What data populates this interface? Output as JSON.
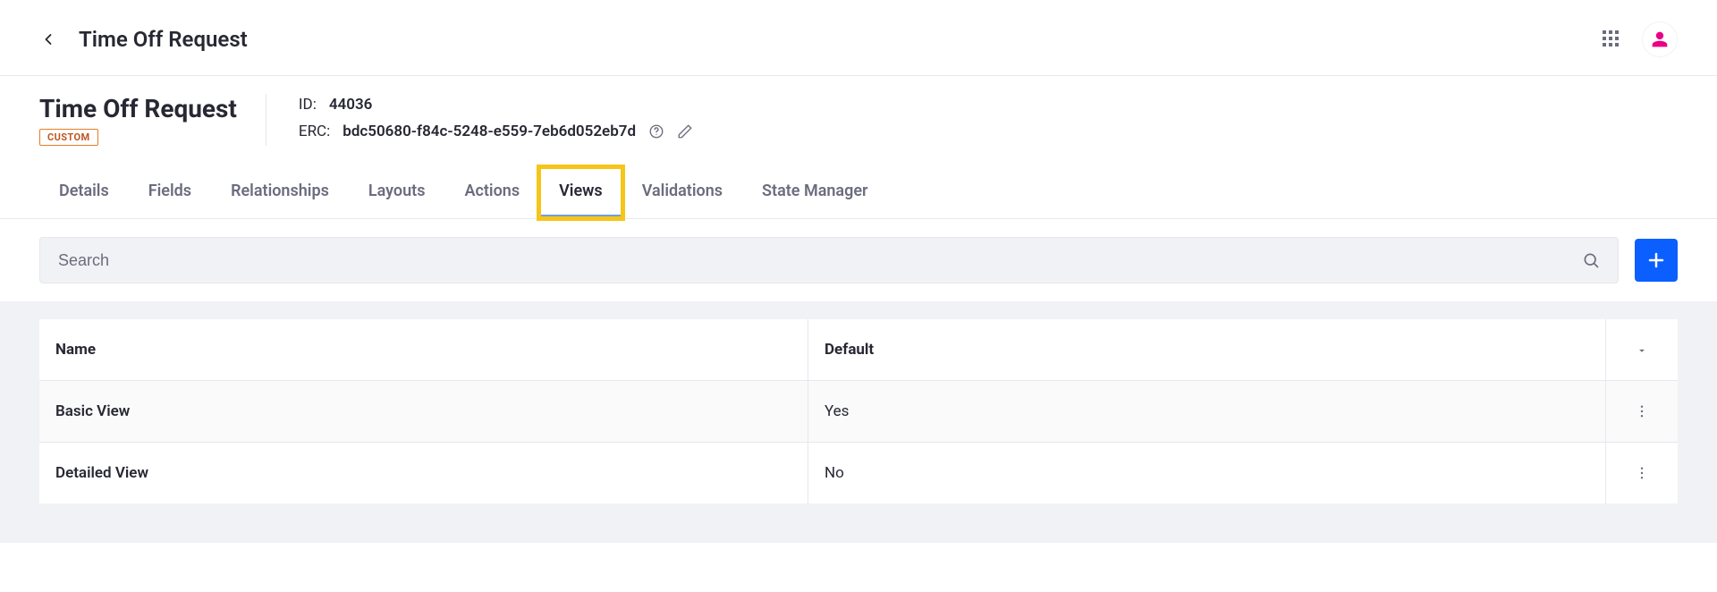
{
  "topbar": {
    "title": "Time Off Request"
  },
  "header": {
    "object_name": "Time Off Request",
    "badge": "CUSTOM",
    "id_label": "ID:",
    "id_value": "44036",
    "erc_label": "ERC:",
    "erc_value": "bdc50680-f84c-5248-e559-7eb6d052eb7d"
  },
  "tabs": [
    {
      "label": "Details",
      "active": false
    },
    {
      "label": "Fields",
      "active": false
    },
    {
      "label": "Relationships",
      "active": false
    },
    {
      "label": "Layouts",
      "active": false
    },
    {
      "label": "Actions",
      "active": false
    },
    {
      "label": "Views",
      "active": true,
      "highlight": true
    },
    {
      "label": "Validations",
      "active": false
    },
    {
      "label": "State Manager",
      "active": false
    }
  ],
  "search": {
    "placeholder": "Search"
  },
  "table": {
    "columns": {
      "name": "Name",
      "default": "Default"
    },
    "rows": [
      {
        "name": "Basic View",
        "default": "Yes"
      },
      {
        "name": "Detailed View",
        "default": "No"
      }
    ]
  }
}
